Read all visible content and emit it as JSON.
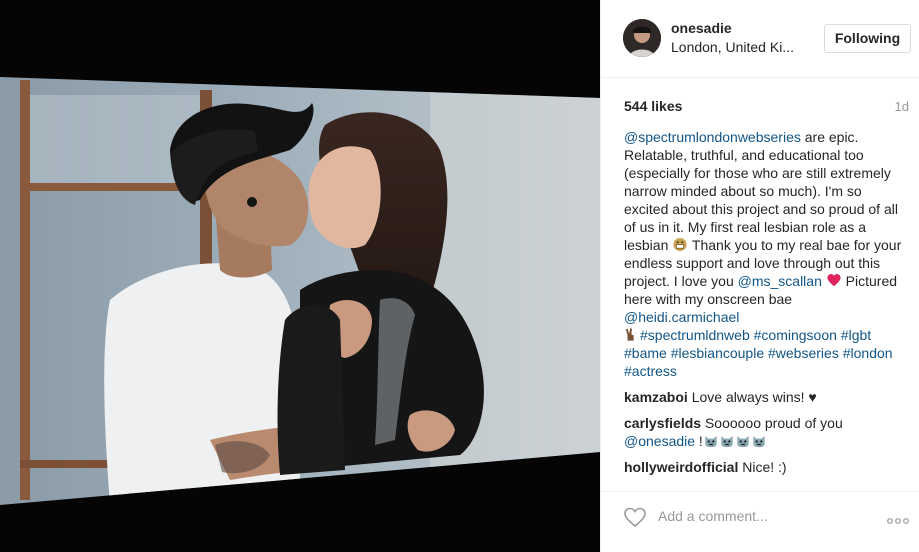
{
  "post": {
    "username": "onesadie",
    "location": "London, United Ki...",
    "follow_label": "Following",
    "likes": "544 likes",
    "time": "1d"
  },
  "caption": {
    "mention_1": "@spectrumlondonwebseries",
    "text_1": " are epic. Relatable, truthful, and educational too (especially for those who are still extremely narrow minded about so much). I'm so excited about this project and so proud of all of us in it. My first real lesbian role as a lesbian ",
    "text_2": " Thank you to my real bae for your endless support and love through out this project. I love you ",
    "mention_2": "@ms_scallan",
    "text_3": " Pictured here with my onscreen bae ",
    "mention_3": "@heidi.carmichael",
    "tag_1": "#spectrumldnweb",
    "tag_2": "#comingsoon",
    "tag_3": "#lgbt",
    "tag_4": "#bame",
    "tag_5": "#lesbiancouple",
    "tag_6": "#webseries",
    "tag_7": "#london",
    "tag_8": "#actress"
  },
  "comments": [
    {
      "user": "kamzaboi",
      "text": " Love always wins! ♥"
    },
    {
      "user": "carlysfields",
      "text": " Soooooo proud of you ",
      "mention": "@onesadie",
      "suffix": " !"
    },
    {
      "user": "hollyweirdofficial",
      "text": " Nice! :)"
    }
  ],
  "footer": {
    "add_comment_placeholder": "Add a comment...",
    "like_icon": "heart-outline-icon",
    "more_icon": "ellipsis-icon"
  },
  "colors": {
    "link": "#125688",
    "meta": "#999999",
    "heart": "#e0245e",
    "border": "#efefef"
  }
}
